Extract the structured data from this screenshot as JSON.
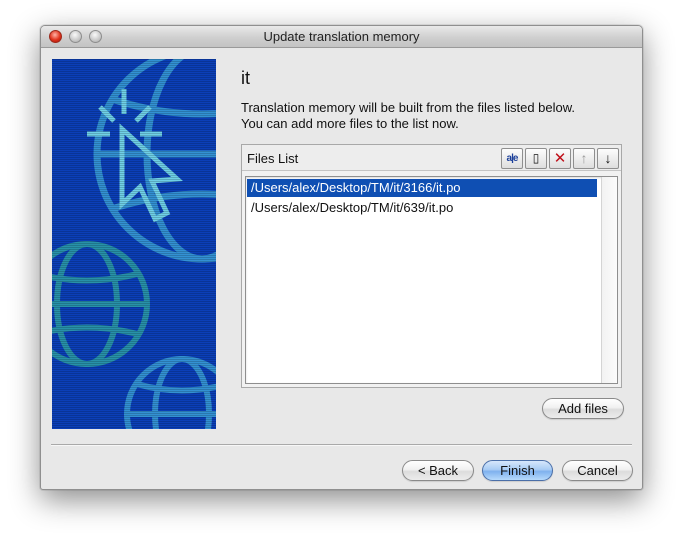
{
  "window": {
    "title": "Update translation memory"
  },
  "page": {
    "heading": "it",
    "description_line1": "Translation memory will be built from the files listed below.",
    "description_line2": "You can add more files to the list now."
  },
  "files_list": {
    "title": "Files List",
    "toolbar": {
      "spellcheck_glyph": "a|e",
      "new_glyph": "▯",
      "delete_glyph": "✕",
      "up_glyph": "↑",
      "down_glyph": "↓"
    },
    "items": [
      {
        "path": "/Users/alex/Desktop/TM/it/3166/it.po",
        "selected": true
      },
      {
        "path": "/Users/alex/Desktop/TM/it/639/it.po",
        "selected": false
      }
    ]
  },
  "buttons": {
    "add_files": "Add files",
    "back": "< Back",
    "finish": "Finish",
    "cancel": "Cancel"
  },
  "colors": {
    "accent_selection": "#0f4fb3",
    "art_background": "#0b3fb8",
    "art_foreground": "#3aa0d8"
  },
  "icons": {
    "art": [
      "cursor-click-icon",
      "globe-icon"
    ]
  }
}
